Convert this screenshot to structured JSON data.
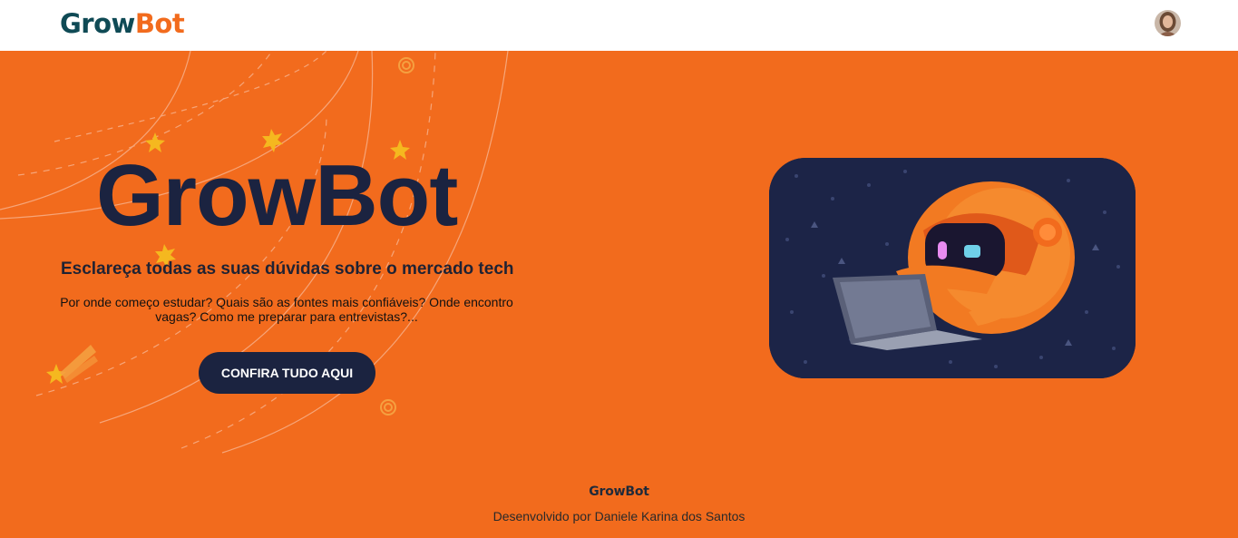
{
  "header": {
    "logo_part1": "Grow",
    "logo_part2": "Bot",
    "avatar_icon": "user-avatar-photo"
  },
  "hero": {
    "title": "GrowBot",
    "subtitle": "Esclareça todas as suas dúvidas sobre o mercado tech",
    "description": "Por onde começo estudar? Quais são as fontes mais confiáveis? Onde encontro vagas? Como me preparar para entrevistas?...",
    "cta_label": "CONFIRA TUDO AQUI",
    "image_icon": "robot-with-laptop-illustration"
  },
  "footer": {
    "logo": "GrowBot",
    "credit": "Desenvolvido por Daniele Karina dos Santos"
  },
  "colors": {
    "brand_orange": "#f26b1d",
    "navy": "#1b2340",
    "logo_teal": "#0f4a55"
  }
}
